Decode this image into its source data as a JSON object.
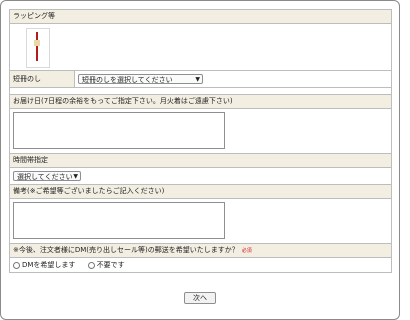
{
  "wrapping": {
    "heading": "ラッピング等",
    "image_icon": "ribbon-wrapping-image"
  },
  "tanzaku": {
    "label": "短冊のし",
    "select_value": "短冊のしを選択してください"
  },
  "delivery_date": {
    "heading": "お届け日(7日程の余裕をもってご指定下さい。月火着はご遠慮下さい)"
  },
  "time_slot": {
    "heading": "時間帯指定",
    "select_value": "選択してください"
  },
  "remarks": {
    "heading": "備考(※ご希望等ございましたらご記入ください)"
  },
  "dm": {
    "question": "※今後、注文者様にDM(売り出しセール等)の郵送を希望いたしますか？",
    "required_label": "必須",
    "options": [
      "DMを希望します",
      "不要です"
    ]
  },
  "next_button": {
    "label": "次へ"
  }
}
